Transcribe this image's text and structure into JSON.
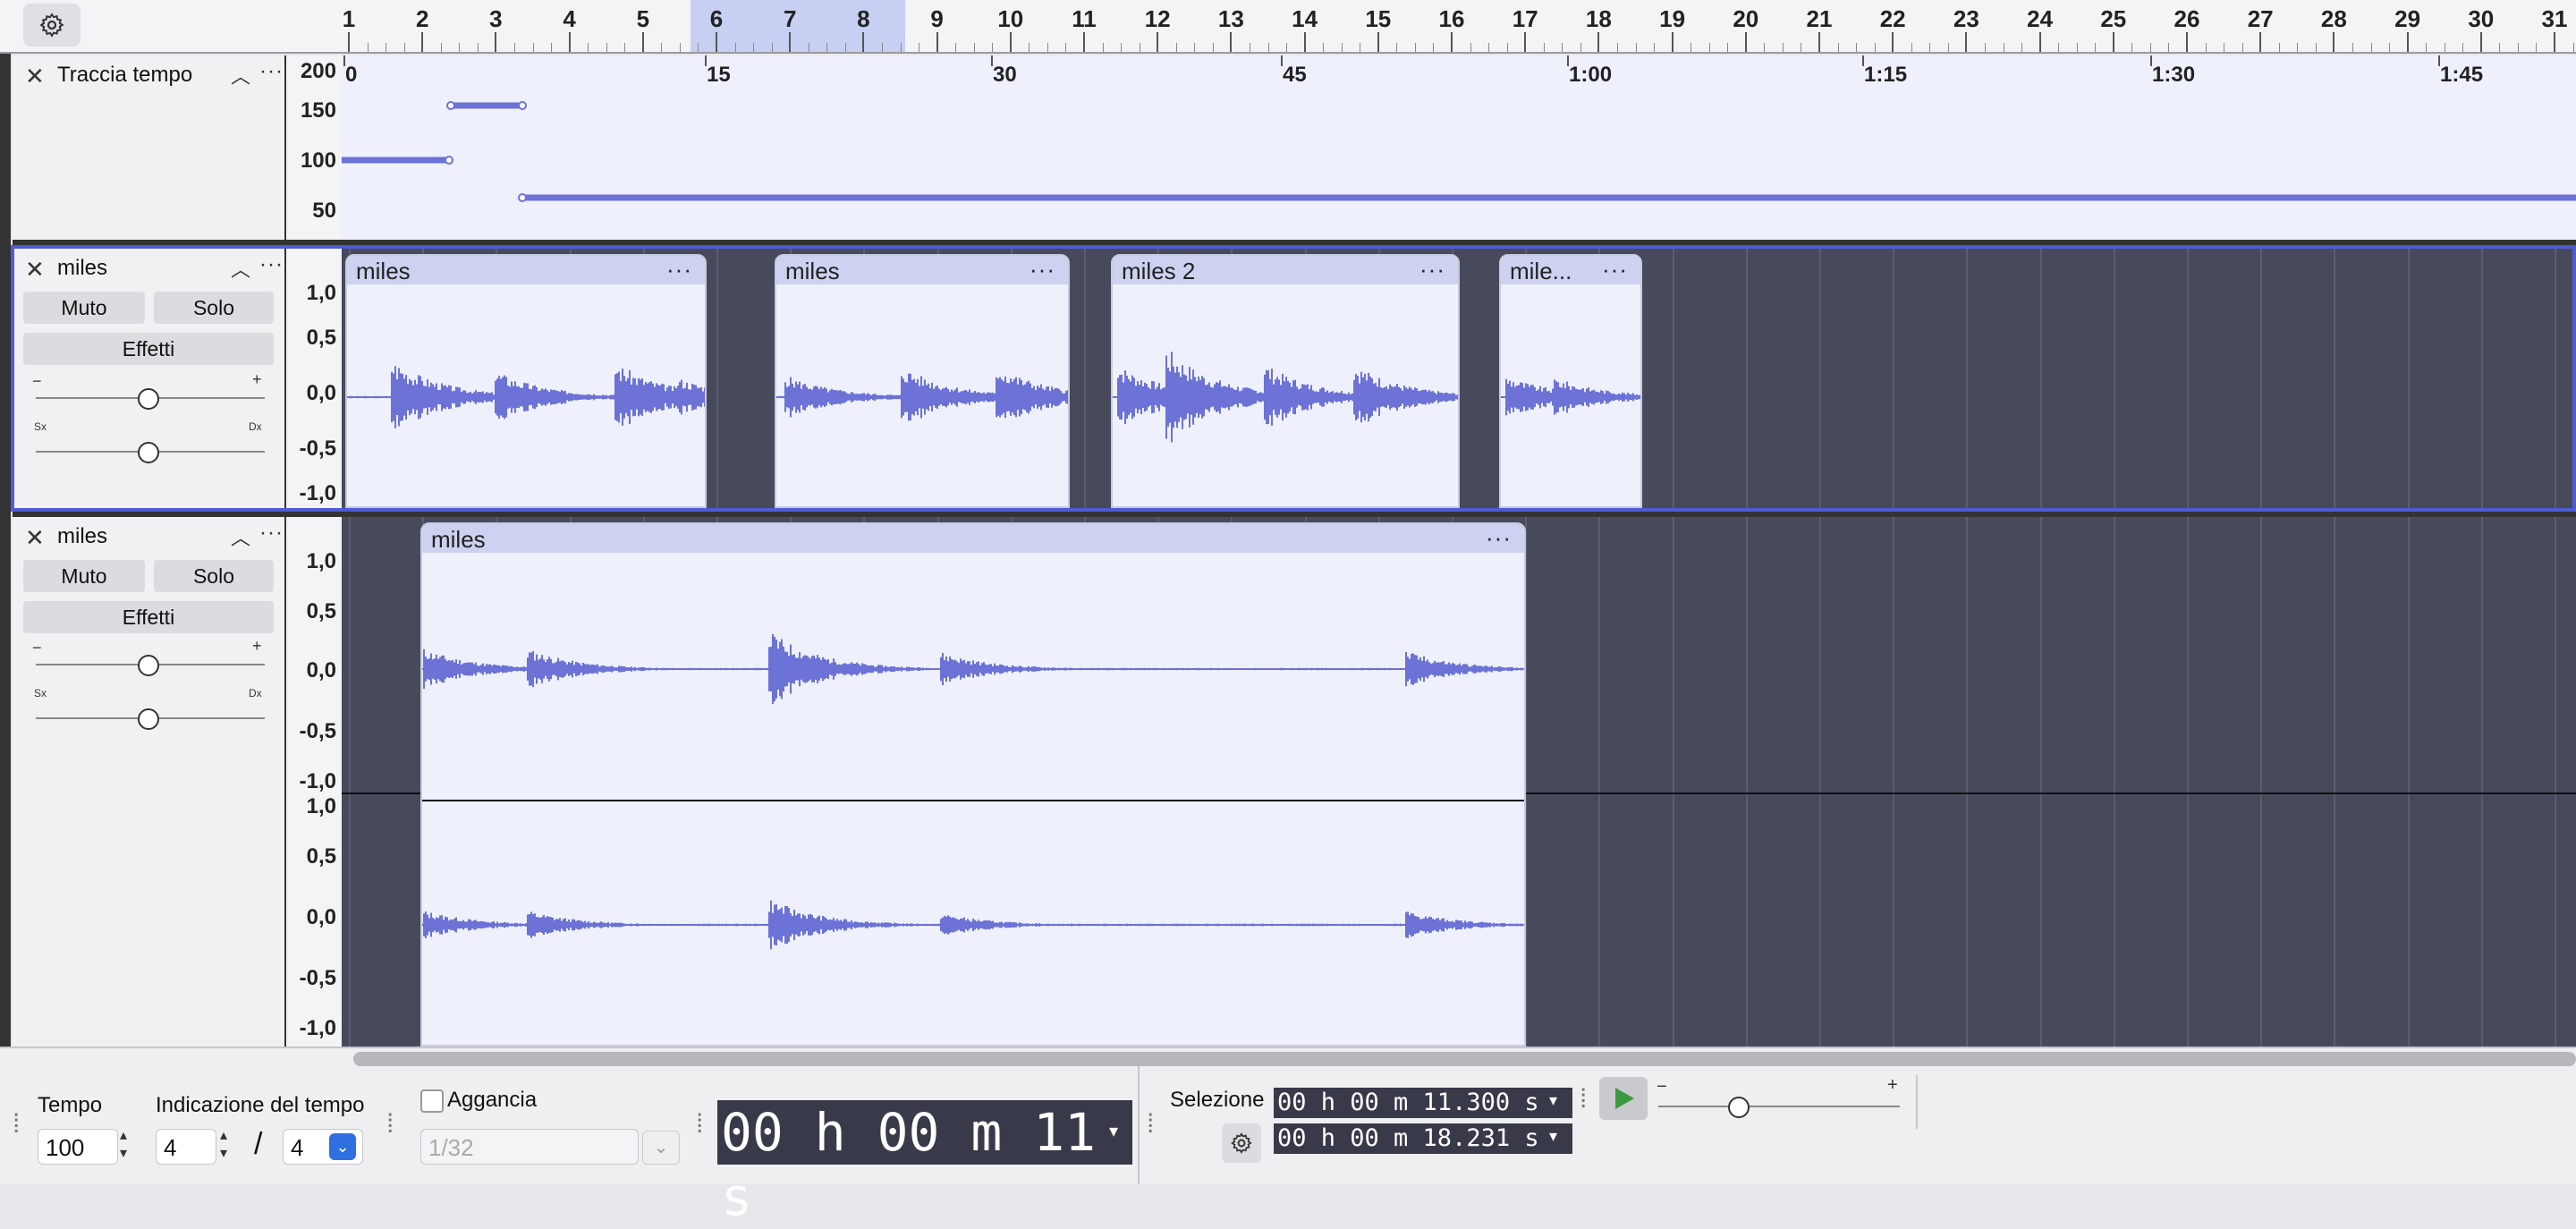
{
  "ruler": {
    "beats": [
      "1",
      "2",
      "3",
      "4",
      "5",
      "6",
      "7",
      "8",
      "9",
      "10",
      "11",
      "12",
      "13",
      "14",
      "15",
      "16",
      "17",
      "18",
      "19",
      "20",
      "21",
      "22",
      "23",
      "24",
      "25",
      "26",
      "27",
      "28",
      "29",
      "30",
      "31"
    ],
    "highlight_beats": [
      "6",
      "7",
      "8"
    ]
  },
  "tempo_track": {
    "name": "Traccia tempo",
    "scale_labels": [
      "200",
      "150",
      "100",
      "50"
    ],
    "time_labels": [
      "0",
      "15",
      "30",
      "45",
      "1:00",
      "1:15",
      "1:30",
      "1:45"
    ]
  },
  "track1": {
    "name": "miles",
    "mute_label": "Muto",
    "solo_label": "Solo",
    "effects_label": "Effetti",
    "gain_minus": "−",
    "gain_plus": "+",
    "pan_left": "Sx",
    "pan_right": "Dx",
    "scale_labels": [
      "1,0",
      "0,5",
      "0,0",
      "-0,5",
      "-1,0"
    ],
    "clips": [
      "miles",
      "miles",
      "miles 2",
      "mile..."
    ]
  },
  "track2": {
    "name": "miles",
    "mute_label": "Muto",
    "solo_label": "Solo",
    "effects_label": "Effetti",
    "gain_minus": "−",
    "gain_plus": "+",
    "pan_left": "Sx",
    "pan_right": "Dx",
    "scale_labels": [
      "1,0",
      "0,5",
      "0,0",
      "-0,5",
      "-1,0"
    ],
    "scale_labels_lower": [
      "1,0",
      "0,5",
      "0,0",
      "-0,5",
      "-1,0"
    ],
    "clip": "miles"
  },
  "toolbar": {
    "tempo_label": "Tempo",
    "tempo_value": "100",
    "signature_label": "Indicazione del tempo",
    "signature_upper": "4",
    "signature_slash": "/",
    "signature_lower": "4",
    "snap_label": "Aggancia",
    "snap_value": "1/32",
    "time_display": "00 h 00 m 11 s",
    "selection_label": "Selezione",
    "selection_start": "00 h 00 m 11.300 s",
    "selection_end": "00 h 00 m 18.231 s",
    "play_minus": "−",
    "play_plus": "+"
  },
  "colors": {
    "waveform": "#6c72d6",
    "selection_outline": "#4f5bd5",
    "clip_header": "#ccd2f0",
    "background_dark": "#474a5b"
  }
}
